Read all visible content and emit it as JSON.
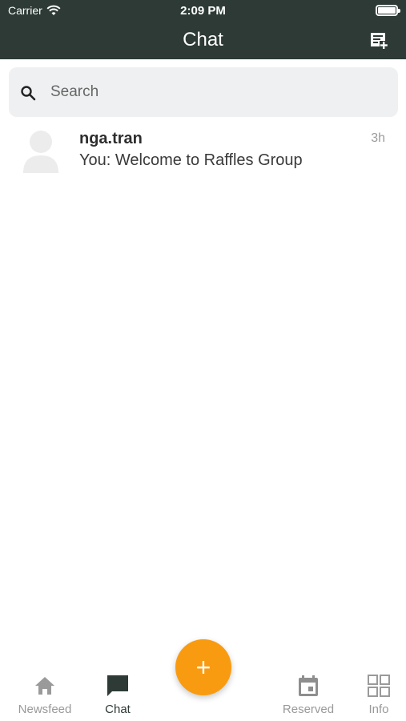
{
  "status_bar": {
    "carrier": "Carrier",
    "time": "2:09 PM"
  },
  "header": {
    "title": "Chat"
  },
  "search": {
    "placeholder": "Search"
  },
  "conversations": [
    {
      "name": "nga.tran",
      "time": "3h",
      "last_message": "You: Welcome to Raffles Group"
    }
  ],
  "fab": {
    "label": "+"
  },
  "tabs": [
    {
      "label": "Newsfeed",
      "icon": "home-icon",
      "active": false
    },
    {
      "label": "Chat",
      "icon": "chat-bubble-icon",
      "active": true
    },
    {
      "label": "Reserved",
      "icon": "calendar-icon",
      "active": false
    },
    {
      "label": "Info",
      "icon": "grid-icon",
      "active": false
    }
  ],
  "colors": {
    "header_bg": "#2d3a36",
    "accent": "#f99b10",
    "inactive": "#999999"
  }
}
